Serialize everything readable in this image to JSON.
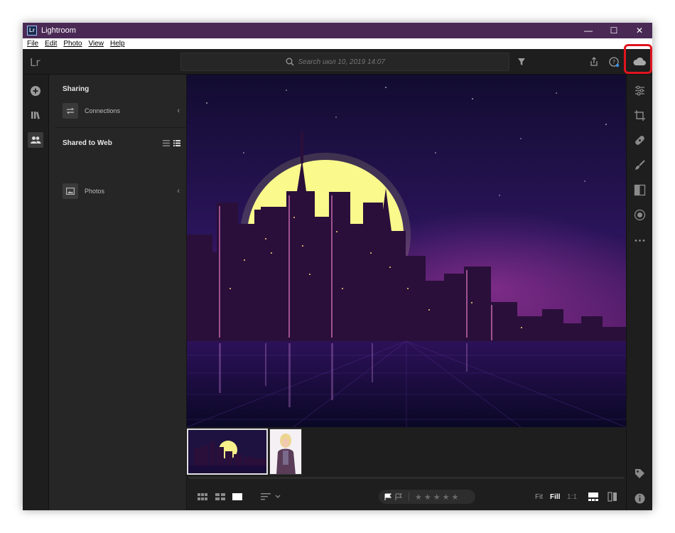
{
  "window": {
    "title": "Lightroom",
    "logo_text": "Lr",
    "controls": {
      "minimize": "—",
      "maximize": "☐",
      "close": "✕"
    }
  },
  "menu": [
    "File",
    "Edit",
    "Photo",
    "View",
    "Help"
  ],
  "toolbar": {
    "brand": "Lr",
    "search_placeholder": "Search июл 10, 2019 14:07"
  },
  "panel": {
    "sharing_heading": "Sharing",
    "connections_label": "Connections",
    "shared_heading": "Shared to Web",
    "photos_label": "Photos"
  },
  "bottombar": {
    "zoom": {
      "fit": "Fit",
      "fill": "Fill",
      "one_to_one": "1:1"
    },
    "rating_stars": 0,
    "max_stars": 5
  },
  "colors": {
    "window_title_bg": "#4a2a55",
    "app_bg": "#1e1e1e",
    "panel_bg": "#262626",
    "highlight": "#e0141e"
  },
  "icons": {
    "left_rail": [
      "add-icon",
      "library-icon",
      "people-icon"
    ],
    "right_rail": [
      "cloud-icon",
      "edit-sliders-icon",
      "crop-icon",
      "healing-icon",
      "brush-icon",
      "linear-gradient-icon",
      "radial-gradient-icon",
      "more-icon",
      "keyword-tag-icon",
      "info-icon"
    ]
  }
}
